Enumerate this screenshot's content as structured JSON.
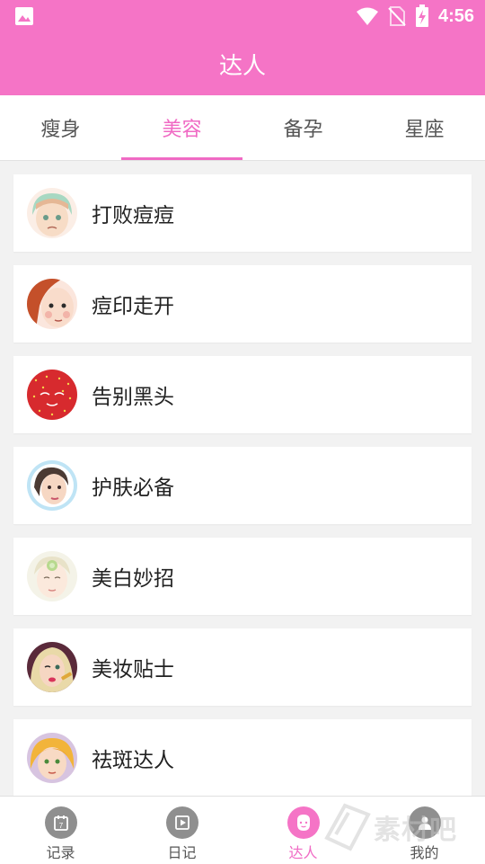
{
  "status_bar": {
    "time": "4:56",
    "icons": [
      "image-icon",
      "wifi-icon",
      "no-sim-icon",
      "battery-charging-icon"
    ]
  },
  "header": {
    "title": "达人"
  },
  "tabs": [
    {
      "label": "瘦身",
      "active": false
    },
    {
      "label": "美容",
      "active": true
    },
    {
      "label": "备孕",
      "active": false
    },
    {
      "label": "星座",
      "active": false
    }
  ],
  "list": {
    "items": [
      {
        "label": "打败痘痘",
        "avatar": "girl-bangs-avatar"
      },
      {
        "label": "痘印走开",
        "avatar": "redhead-girl-avatar"
      },
      {
        "label": "告别黑头",
        "avatar": "strawberry-avatar"
      },
      {
        "label": "护肤必备",
        "avatar": "skincare-woman-avatar"
      },
      {
        "label": "美白妙招",
        "avatar": "face-mask-woman-avatar"
      },
      {
        "label": "美妆贴士",
        "avatar": "makeup-woman-avatar"
      },
      {
        "label": "祛斑达人",
        "avatar": "blonde-freckle-avatar"
      }
    ]
  },
  "bottom_nav": {
    "items": [
      {
        "label": "记录",
        "icon": "calendar-icon",
        "active": false
      },
      {
        "label": "日记",
        "icon": "play-book-icon",
        "active": false
      },
      {
        "label": "达人",
        "icon": "face-icon",
        "active": true
      },
      {
        "label": "我的",
        "icon": "person-icon",
        "active": false
      }
    ]
  },
  "watermark": {
    "text": "素材吧"
  },
  "colors": {
    "accent": "#f574c6",
    "active_text": "#f06ac4",
    "background": "#f2f2f2"
  }
}
